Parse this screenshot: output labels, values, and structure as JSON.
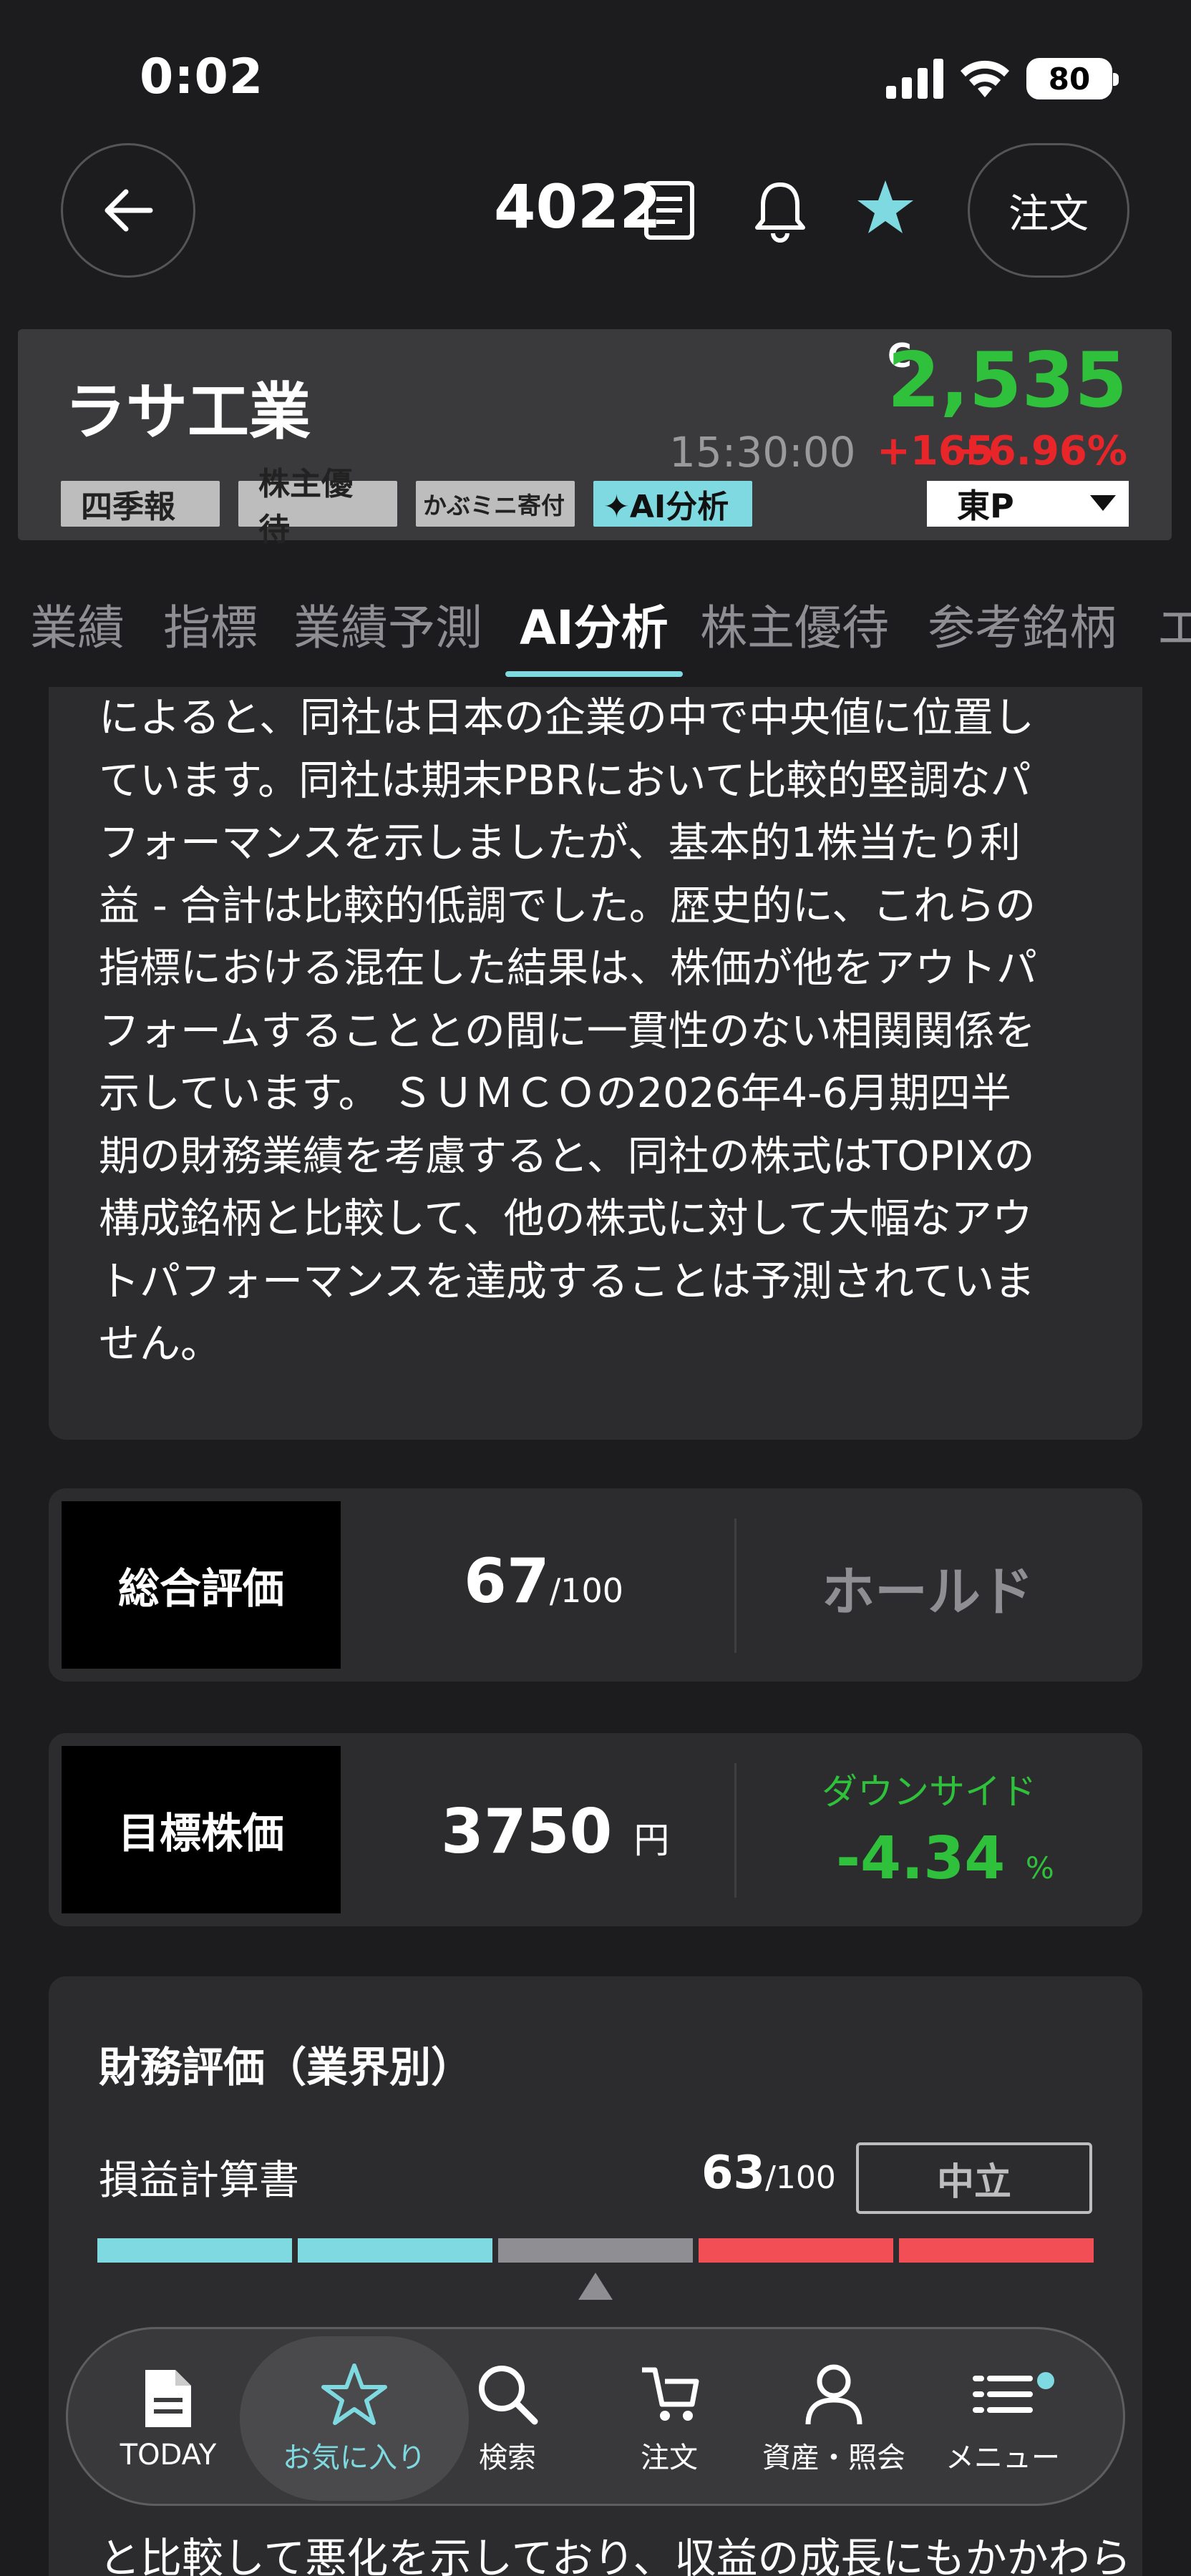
{
  "status": {
    "time": "0:02",
    "battery": "80"
  },
  "header": {
    "ticker": "4022",
    "order_label": "注文"
  },
  "stock": {
    "name": "ラサ工業",
    "c_mark": "C",
    "price": "2,535",
    "time": "15:30:00",
    "change": "+165",
    "change_pct": "+6.96%",
    "badges": [
      "四季報",
      "株主優待",
      "かぶミニ寄付",
      "✦AI分析"
    ],
    "market": "東P"
  },
  "tabs": [
    "業績",
    "指標",
    "業績予測",
    "AI分析",
    "株主優待",
    "参考銘柄",
    "エ"
  ],
  "analysis_text": [
    "によると、同社は日本の企業の中で中央値に位置し",
    "ています。同社は期末PBRにおいて比較的堅調なパ",
    "フォーマンスを示しましたが、基本的1株当たり利",
    "益 - 合計は比較的低調でした。歴史的に、これらの",
    "指標における混在した結果は、株価が他をアウトパ",
    "フォームすることとの間に一貫性のない相関関係を",
    "示しています。 ＳＵＭＣＯの2026年4-6月期四半",
    "期の財務業績を考慮すると、同社の株式はTOPIXの",
    "構成銘柄と比較して、他の株式に対して大幅なアウ",
    "トパフォーマンスを達成することは予測されていま",
    "せん。"
  ],
  "overall": {
    "label": "総合評価",
    "score": "67",
    "score_max": "/100",
    "rating": "ホールド"
  },
  "target": {
    "label": "目標株価",
    "price": "3750",
    "unit": "円",
    "direction": "ダウンサイド",
    "pct": "-4.34",
    "pct_unit": "%"
  },
  "financial": {
    "title": "財務評価（業界別）",
    "row_label": "損益計算書",
    "score": "63",
    "score_max": "/100",
    "rating": "中立",
    "level_segment": 3,
    "segment_colors": [
      "#7fd9e0",
      "#7fd9e0",
      "#8e8e93",
      "#f24e55",
      "#f24e55"
    ]
  },
  "bottom_text": "と比較して悪化を示しており、収益の成長にもかかわら",
  "nav": [
    {
      "label": "TODAY",
      "icon": "document-icon"
    },
    {
      "label": "お気に入り",
      "icon": "star-outline-icon"
    },
    {
      "label": "検索",
      "icon": "search-icon"
    },
    {
      "label": "注文",
      "icon": "cart-icon"
    },
    {
      "label": "資産・照会",
      "icon": "person-icon"
    },
    {
      "label": "メニュー",
      "icon": "menu-icon"
    }
  ],
  "colors": {
    "accent": "#7fd9e0",
    "up_green": "#2fc13b",
    "down_red": "#e8262a"
  }
}
